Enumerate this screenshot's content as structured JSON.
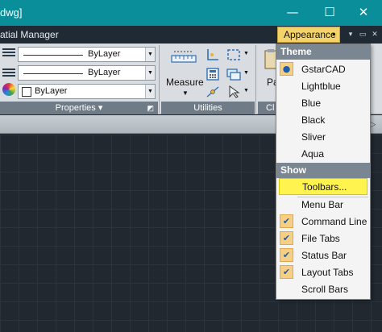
{
  "window": {
    "title": "dwg]",
    "minimize_glyph": "—",
    "maximize_glyph": "☐",
    "close_glyph": "✕"
  },
  "menubar": {
    "title": "atial Manager",
    "appearance_label": "Appearance",
    "appearance_caret": "▾",
    "mini_min": "▾",
    "mini_restore": "▭",
    "mini_close": "✕"
  },
  "ribbon": {
    "combos": {
      "linetype_value": "ByLayer",
      "lineweight_value": "ByLayer",
      "color_value": "ByLayer"
    },
    "combo_arrow": "▼",
    "measure_label": "Measure",
    "measure_caret": "▼",
    "paste_label": "Pa",
    "panels": {
      "properties": "Properties",
      "properties_caret": "▾",
      "properties_launcher": "◩",
      "utilities": "Utilities",
      "third": "Cl"
    }
  },
  "tabstrip": {
    "arrow": "▷"
  },
  "dropdown": {
    "theme_header": "Theme",
    "themes": [
      {
        "label": "GstarCAD",
        "selected": true
      },
      {
        "label": "Lightblue",
        "selected": false
      },
      {
        "label": "Blue",
        "selected": false
      },
      {
        "label": "Black",
        "selected": false
      },
      {
        "label": "Sliver",
        "selected": false
      },
      {
        "label": "Aqua",
        "selected": false
      }
    ],
    "show_header": "Show",
    "show_items": [
      {
        "label": "Toolbars...",
        "checked": false,
        "highlighted": true
      },
      {
        "label": "Menu Bar",
        "checked": false
      },
      {
        "label": "Command Line",
        "checked": true
      },
      {
        "label": "File Tabs",
        "checked": true
      },
      {
        "label": "Status Bar",
        "checked": true
      },
      {
        "label": "Layout Tabs",
        "checked": true
      },
      {
        "label": "Scroll Bars",
        "checked": false
      }
    ],
    "selected_glyph": "●",
    "check_glyph": "✔"
  },
  "colors": {
    "titlebar": "#0a8f9a",
    "appearance_button": "#f5d36b",
    "highlight": "#fff44f",
    "canvas": "#212830",
    "section_header": "#7a8691"
  }
}
